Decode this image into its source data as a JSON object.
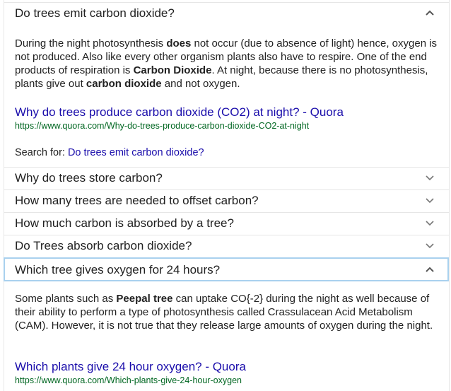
{
  "q1": {
    "question": "Do trees emit carbon dioxide?",
    "chevron": "chevron-up-icon",
    "answer": {
      "t1": "During the night photosynthesis ",
      "b1": "does",
      "t2": " not occur (due to absence of light) hence, oxygen is not produced. Also like every other organism plants also have to respire. One of the end products of respiration is ",
      "b2": "Carbon Dioxide",
      "t3": ". At night, because there is no photosynthesis, plants give out ",
      "b3": "carbon dioxide",
      "t4": " and not oxygen."
    },
    "source_title": "Why do trees produce carbon dioxide (CO2) at night? - Quora",
    "source_url": "https://www.quora.com/Why-do-trees-produce-carbon-dioxide-CO2-at-night",
    "search_for_label": "Search for: ",
    "search_for_link": "Do trees emit carbon dioxide?"
  },
  "collapsed": [
    {
      "question": "Why do trees store carbon?",
      "chevron": "chevron-down-icon"
    },
    {
      "question": "How many trees are needed to offset carbon?",
      "chevron": "chevron-down-icon"
    },
    {
      "question": "How much carbon is absorbed by a tree?",
      "chevron": "chevron-down-icon"
    },
    {
      "question": "Do Trees absorb carbon dioxide?",
      "chevron": "chevron-down-icon"
    }
  ],
  "q2": {
    "question": "Which tree gives oxygen for 24 hours?",
    "chevron": "chevron-up-icon",
    "answer": {
      "t1": "Some plants such as ",
      "b1": "Peepal tree",
      "t2": " can uptake CO{-2} during the night as well because of their ability to perform a type of photosynthesis called Crassulacean Acid Metabolism (CAM). However, it is not true that they release large amounts of oxygen during the night."
    },
    "source_title": "Which plants give 24 hour oxygen? - Quora",
    "source_url": "https://www.quora.com/Which-plants-give-24-hour-oxygen"
  },
  "colors": {
    "link": "#1a0dab",
    "url": "#006621",
    "text": "#222222",
    "active_border": "#a9d1ee"
  }
}
